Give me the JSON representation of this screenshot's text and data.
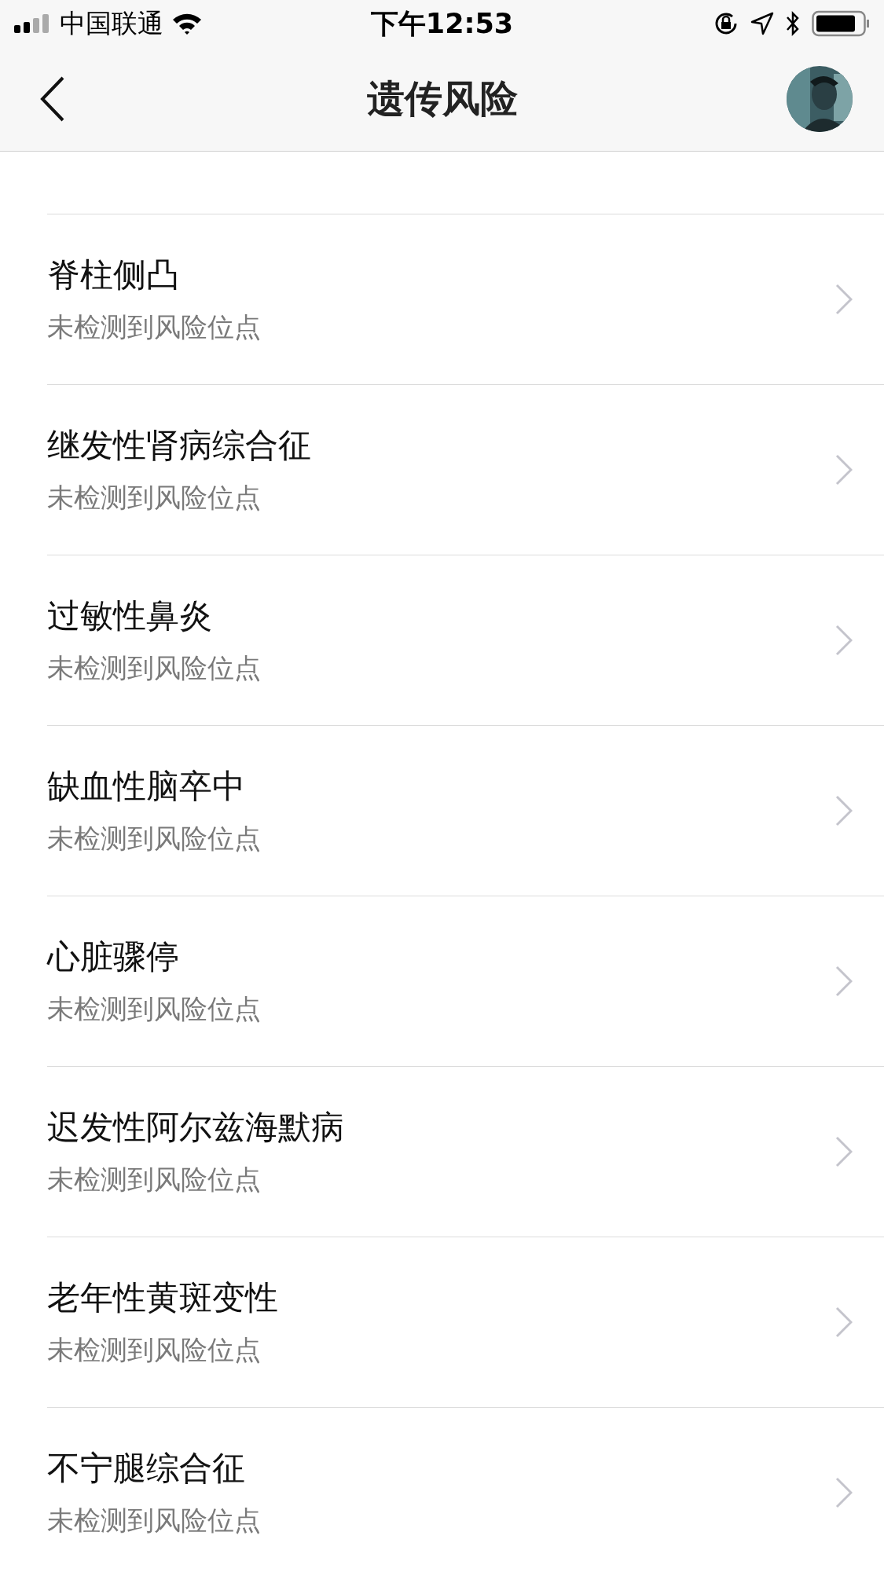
{
  "status_bar": {
    "carrier": "中国联通",
    "time": "下午12:53"
  },
  "nav_bar": {
    "title": "遗传风险"
  },
  "items": [
    {
      "title": "脊柱侧凸",
      "subtitle": "未检测到风险位点"
    },
    {
      "title": "继发性肾病综合征",
      "subtitle": "未检测到风险位点"
    },
    {
      "title": "过敏性鼻炎",
      "subtitle": "未检测到风险位点"
    },
    {
      "title": "缺血性脑卒中",
      "subtitle": "未检测到风险位点"
    },
    {
      "title": "心脏骤停",
      "subtitle": "未检测到风险位点"
    },
    {
      "title": "迟发性阿尔兹海默病",
      "subtitle": "未检测到风险位点"
    },
    {
      "title": "老年性黄斑变性",
      "subtitle": "未检测到风险位点"
    },
    {
      "title": "不宁腿综合征",
      "subtitle": "未检测到风险位点"
    }
  ]
}
